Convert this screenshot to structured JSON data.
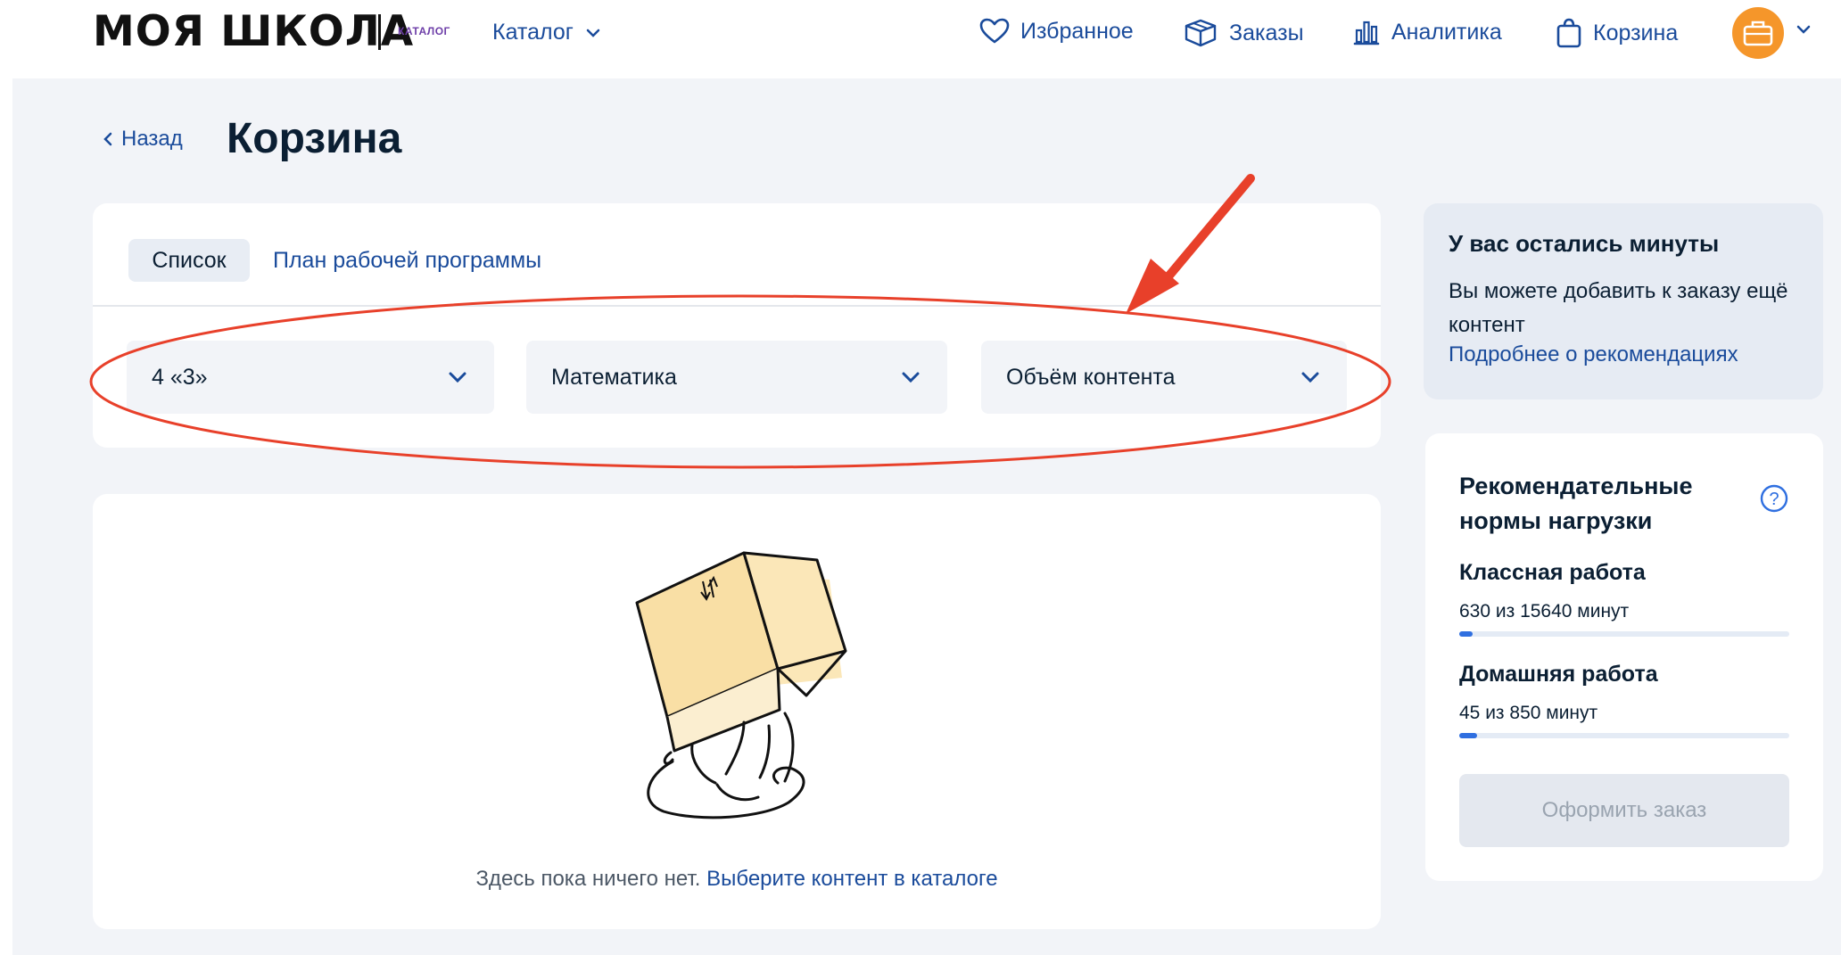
{
  "header": {
    "logo": "МОЯ ШКОЛА",
    "logo_badge": "КАТАЛОГ",
    "catalog_label": "Каталог",
    "nav": [
      {
        "label": "Избранное",
        "icon": "heart-icon"
      },
      {
        "label": "Заказы",
        "icon": "box-icon"
      },
      {
        "label": "Аналитика",
        "icon": "bar-chart-icon"
      },
      {
        "label": "Корзина",
        "icon": "bag-icon"
      }
    ],
    "avatar_icon": "briefcase-icon"
  },
  "page": {
    "back_label": "Назад",
    "title": "Корзина"
  },
  "tabs": {
    "active": "Список",
    "other": "План рабочей программы"
  },
  "filters": {
    "class": "4 «3»",
    "subject": "Математика",
    "volume": "Объём контента"
  },
  "empty": {
    "text": "Здесь пока ничего нет.",
    "link": "Выберите контент в каталоге"
  },
  "minutes_card": {
    "title": "У вас остались минуты",
    "text": "Вы можете добавить к заказу ещё контент",
    "link": "Подробнее о рекомендациях"
  },
  "norms": {
    "title": "Рекомендательные нормы нагрузки",
    "items": [
      {
        "label": "Классная работа",
        "value": "630 из 15640 минут",
        "progress": 0.04
      },
      {
        "label": "Домашняя работа",
        "value": "45 из 850 минут",
        "progress": 0.053
      }
    ],
    "button": "Оформить заказ"
  },
  "colors": {
    "accent": "#1a4b9b",
    "annotation": "#e8402a",
    "avatar": "#f5962a"
  }
}
